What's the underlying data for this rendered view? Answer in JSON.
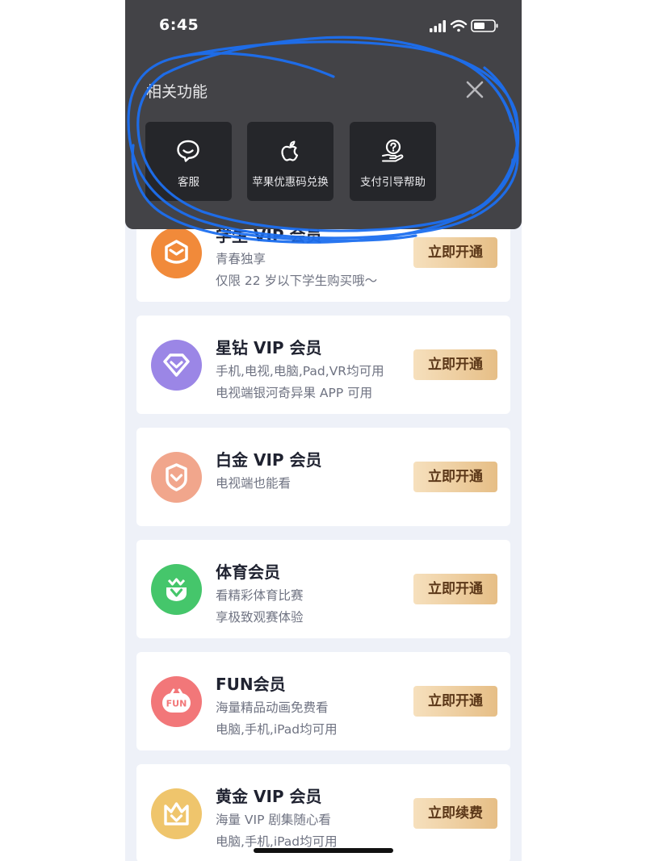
{
  "status_bar": {
    "time": "6:45"
  },
  "overlay": {
    "title": "相关功能",
    "functions": [
      {
        "label": "客服",
        "icon": "chat-bubble-icon"
      },
      {
        "label": "苹果优惠码兑换",
        "icon": "apple-icon"
      },
      {
        "label": "支付引导帮助",
        "icon": "help-hand-icon"
      }
    ]
  },
  "memberships": [
    {
      "title": "学生 VIP 会员",
      "line1": "青春独享",
      "line2": "仅限 22 岁以下学生购买哦～",
      "button": "立即开通",
      "icon": "student-badge-icon",
      "color": "#f08a3c"
    },
    {
      "title": "星钻 VIP 会员",
      "line1": "手机,电视,电脑,Pad,VR均可用",
      "line2": "电视端银河奇异果 APP 可用",
      "button": "立即开通",
      "icon": "diamond-icon",
      "color": "#9a86e8"
    },
    {
      "title": "白金 VIP 会员",
      "line1": "电视端也能看",
      "line2": "",
      "button": "立即开通",
      "icon": "platinum-shield-icon",
      "color": "#f0a58a"
    },
    {
      "title": "体育会员",
      "line1": "看精彩体育比赛",
      "line2": "享极致观赛体验",
      "button": "立即开通",
      "icon": "sports-crown-icon",
      "color": "#46c86a"
    },
    {
      "title": "FUN会员",
      "line1": "海量精品动画免费看",
      "line2": "电脑,手机,iPad均可用",
      "button": "立即开通",
      "icon": "fun-badge-icon",
      "color": "#f0767a"
    },
    {
      "title": "黄金 VIP 会员",
      "line1": "海量 VIP 剧集随心看",
      "line2": "电脑,手机,iPad均可用",
      "button": "立即续费",
      "icon": "gold-crown-icon",
      "color": "#eec46c"
    }
  ]
}
